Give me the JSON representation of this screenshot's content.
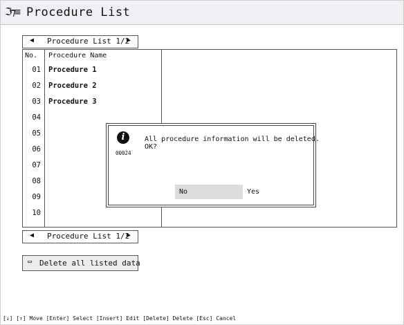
{
  "title": {
    "icon": "procedure-icon",
    "icon_glyph": "ℑ⁊≡",
    "text": "Procedure List"
  },
  "pager_top": {
    "prev_glyph": "◀",
    "label": "Procedure List 1/2",
    "next_glyph": "▶"
  },
  "pager_bottom": {
    "prev_glyph": "◀",
    "label": "Procedure List  1/2",
    "next_glyph": "▶"
  },
  "table": {
    "col_no": "No.",
    "col_name": "Procedure Name",
    "rows": [
      {
        "no": "01",
        "name": "Procedure 1"
      },
      {
        "no": "02",
        "name": "Procedure 2"
      },
      {
        "no": "03",
        "name": "Procedure 3"
      },
      {
        "no": "04",
        "name": ""
      },
      {
        "no": "05",
        "name": ""
      },
      {
        "no": "06",
        "name": ""
      },
      {
        "no": "07",
        "name": ""
      },
      {
        "no": "08",
        "name": ""
      },
      {
        "no": "09",
        "name": ""
      },
      {
        "no": "10",
        "name": ""
      }
    ]
  },
  "dialog": {
    "icon": "info-icon",
    "icon_glyph": "i",
    "code": "00024",
    "message": "All procedure information will be deleted.\nOK?",
    "no_label": "No",
    "yes_label": "Yes"
  },
  "delete_button": {
    "icon_glyph": "▭",
    "label": "Delete all listed data"
  },
  "help": "[↓] [↑] Move  [Enter] Select  [Insert] Edit  [Delete] Delete  [Esc] Cancel"
}
